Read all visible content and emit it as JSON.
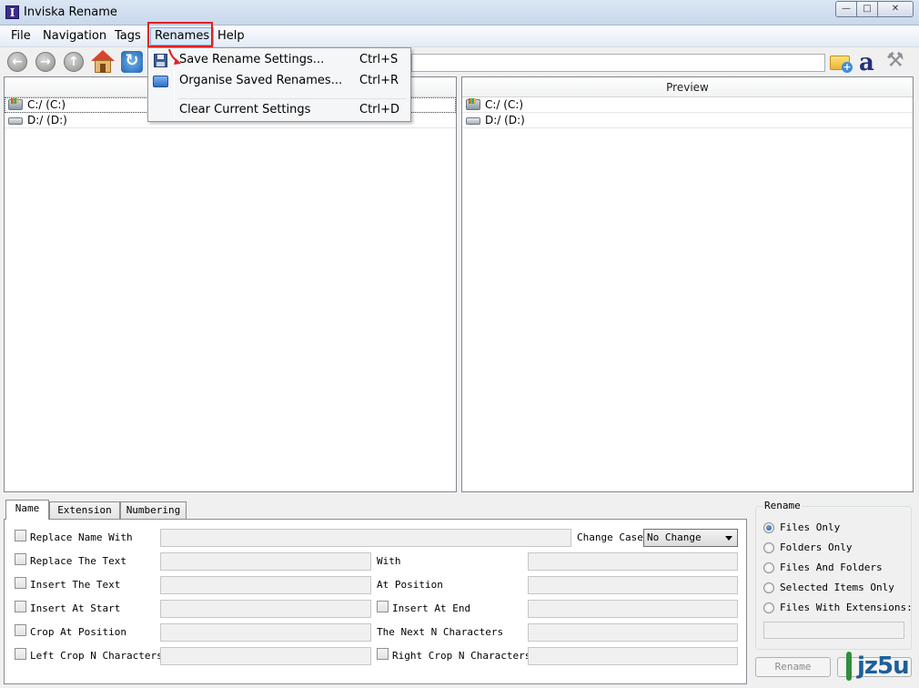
{
  "window": {
    "title": "Inviska Rename"
  },
  "menubar": {
    "items": [
      "File",
      "Navigation",
      "Tags",
      "Renames",
      "Help"
    ]
  },
  "renames_menu": {
    "items": [
      {
        "label": "Save Rename Settings...",
        "shortcut": "Ctrl+S",
        "icon": "save-icon"
      },
      {
        "label": "Organise Saved Renames...",
        "shortcut": "Ctrl+R",
        "icon": "organise-icon"
      },
      {
        "label": "Clear Current Settings",
        "shortcut": "Ctrl+D"
      }
    ]
  },
  "toolbar": {
    "path_value": ""
  },
  "left_pane": {
    "header": "",
    "drives": [
      "C:/ (C:)",
      "D:/ (D:)"
    ]
  },
  "right_pane": {
    "header": "Preview",
    "drives": [
      "C:/ (C:)",
      "D:/ (D:)"
    ]
  },
  "tabs": [
    "Name",
    "Extension",
    "Numbering"
  ],
  "name_tab": {
    "replace_name_with": "Replace Name With",
    "change_case": "Change Case",
    "change_case_value": "No Change",
    "replace_the_text": "Replace The Text",
    "with": "With",
    "insert_the_text": "Insert The Text",
    "at_position": "At Position",
    "insert_at_start": "Insert At Start",
    "insert_at_end": "Insert At End",
    "crop_at_position": "Crop At Position",
    "next_n_characters": "The Next N Characters",
    "left_crop": "Left Crop N Characters",
    "right_crop": "Right Crop N Characters"
  },
  "rename_group": {
    "title": "Rename",
    "options": [
      "Files Only",
      "Folders Only",
      "Files And Folders",
      "Selected Items Only",
      "Files With Extensions:"
    ],
    "selected_index": 0,
    "rename_button": "Rename"
  },
  "watermark": {
    "text": "jz5u"
  },
  "colors": {
    "highlight": "#e02020",
    "title_bar": "#c9d8ec"
  }
}
